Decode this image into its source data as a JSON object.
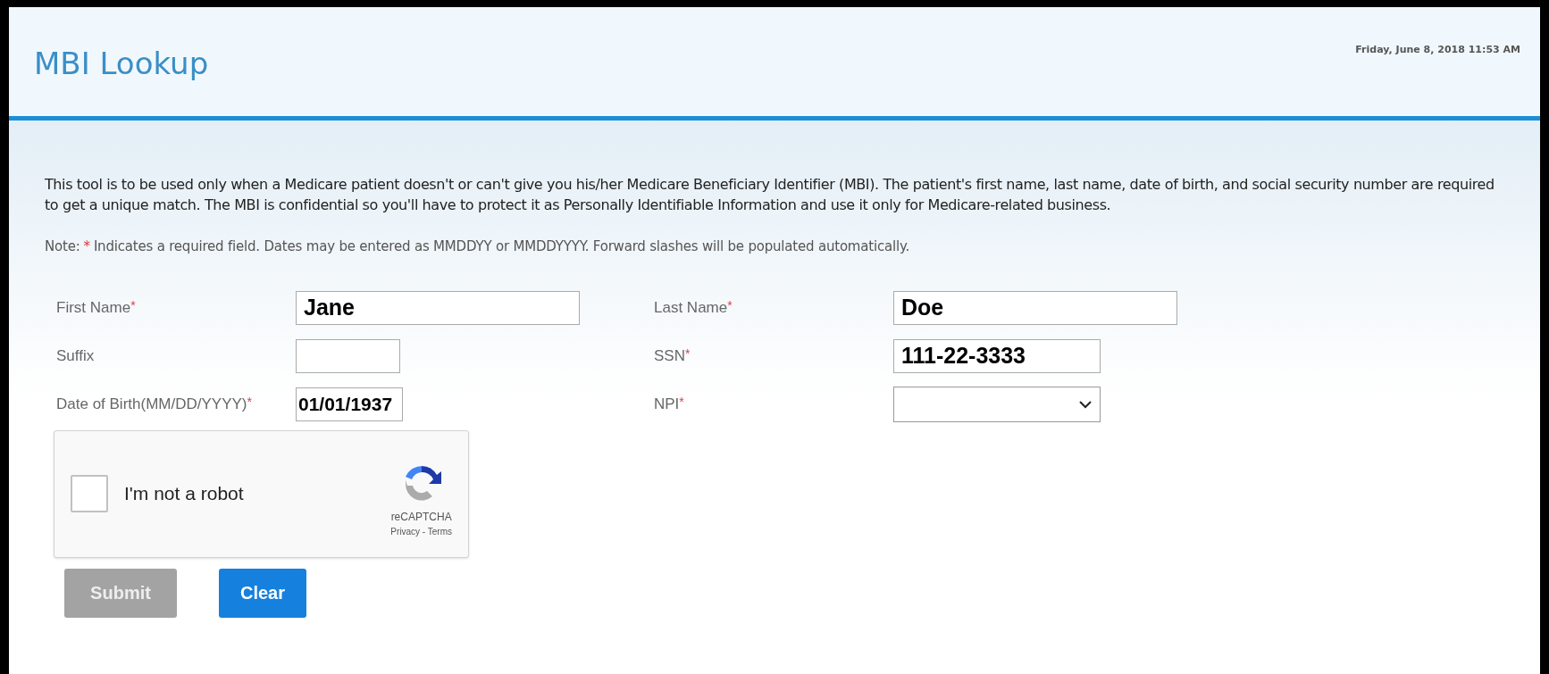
{
  "header": {
    "title": "MBI Lookup",
    "datetime": "Friday, June 8, 2018 11:53 AM"
  },
  "intro": "This tool is to be used only when a Medicare patient doesn't or can't give you his/her Medicare Beneficiary Identifier (MBI). The patient's first name, last name, date of birth, and social security number are required to get a unique match. The MBI is confidential so you'll have to protect it as Personally Identifiable Information and use it only for Medicare-related business.",
  "note": {
    "label": "Note:",
    "required_mark": "*",
    "text": "Indicates a required field. Dates may be entered as MMDDYY or MMDDYYYY. Forward slashes will be populated automatically."
  },
  "left_fields": [
    {
      "label": "First Name",
      "required_mark": "*",
      "kind": "text",
      "value": "Jane"
    },
    {
      "label": "Suffix",
      "kind": "text"
    },
    {
      "label": "Date of Birth(MM/DD/YYYY)",
      "required_mark": "*",
      "kind": "text",
      "value": "01/01/1937"
    }
  ],
  "right_fields": [
    {
      "label": "Last Name",
      "required_mark": "*",
      "kind": "text",
      "value": "Doe"
    },
    {
      "label": "SSN",
      "required_mark": "*",
      "kind": "text",
      "value": "111-22-3333"
    },
    {
      "label": "NPI",
      "required_mark": "*",
      "kind": "select"
    }
  ],
  "captcha": {
    "label": "I'm not a robot",
    "checked": false,
    "brand": "reCAPTCHA",
    "links": "Privacy - Terms"
  },
  "buttons": [
    {
      "label": "Submit",
      "disabled": true
    },
    {
      "label": "Clear",
      "disabled": false
    }
  ]
}
